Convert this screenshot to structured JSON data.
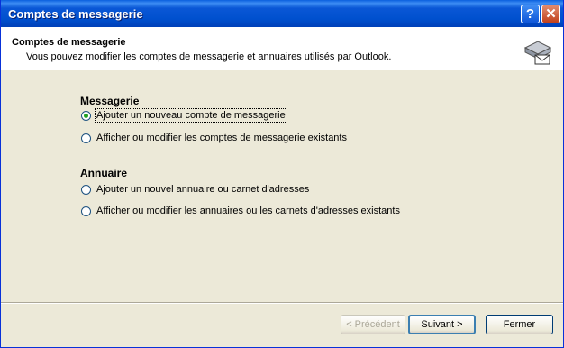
{
  "window": {
    "title": "Comptes de messagerie"
  },
  "header": {
    "title": "Comptes de messagerie",
    "subtitle": "Vous pouvez modifier les comptes de messagerie et annuaires utilisés par Outlook."
  },
  "messagerie": {
    "heading": "Messagerie",
    "options": [
      {
        "label": "Ajouter un nouveau compte de messagerie",
        "checked": true
      },
      {
        "label": "Afficher ou modifier les comptes de messagerie existants",
        "checked": false
      }
    ]
  },
  "annuaire": {
    "heading": "Annuaire",
    "options": [
      {
        "label": "Ajouter un nouvel annuaire ou carnet d'adresses",
        "checked": false
      },
      {
        "label": "Afficher ou modifier les annuaires ou les carnets d'adresses existants",
        "checked": false
      }
    ]
  },
  "buttons": {
    "previous": "< Précédent",
    "next": "Suivant >",
    "close": "Fermer"
  },
  "icons": {
    "help": "help-icon",
    "close": "close-icon",
    "header": "mail-accounts-icon"
  },
  "colors": {
    "titlebar": "#0050ce",
    "face": "#ece9d8",
    "radio_dot": "#21a121"
  }
}
